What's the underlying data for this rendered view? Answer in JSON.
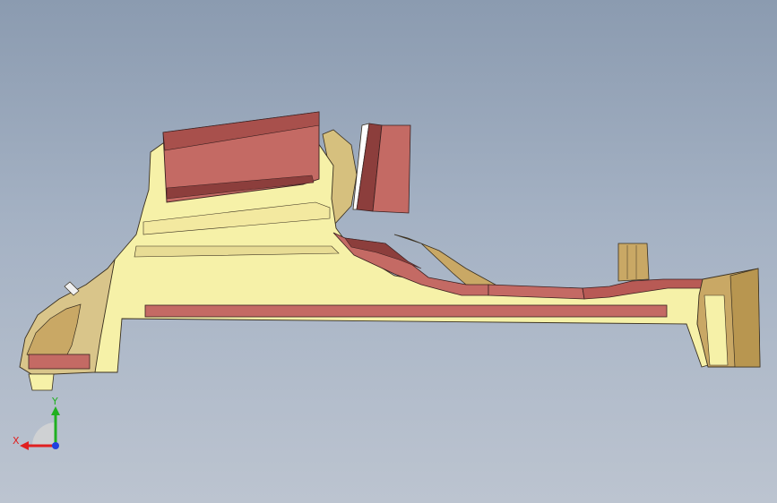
{
  "viewport": {
    "background_top": "#8b9bb0",
    "background_bottom": "#bcc4d0"
  },
  "colors": {
    "body_light": "#f6f1a8",
    "body_shade": "#d8c98a",
    "wall_tan": "#c9a865",
    "red_face": "#c46a64",
    "red_dark": "#8c3e3c",
    "red_top": "#a8504c",
    "edge": "#3a3020"
  },
  "triad": {
    "x_label": "X",
    "y_label": "Y",
    "x_color": "#e02020",
    "y_color": "#20b020",
    "z_color": "#2040e0"
  }
}
